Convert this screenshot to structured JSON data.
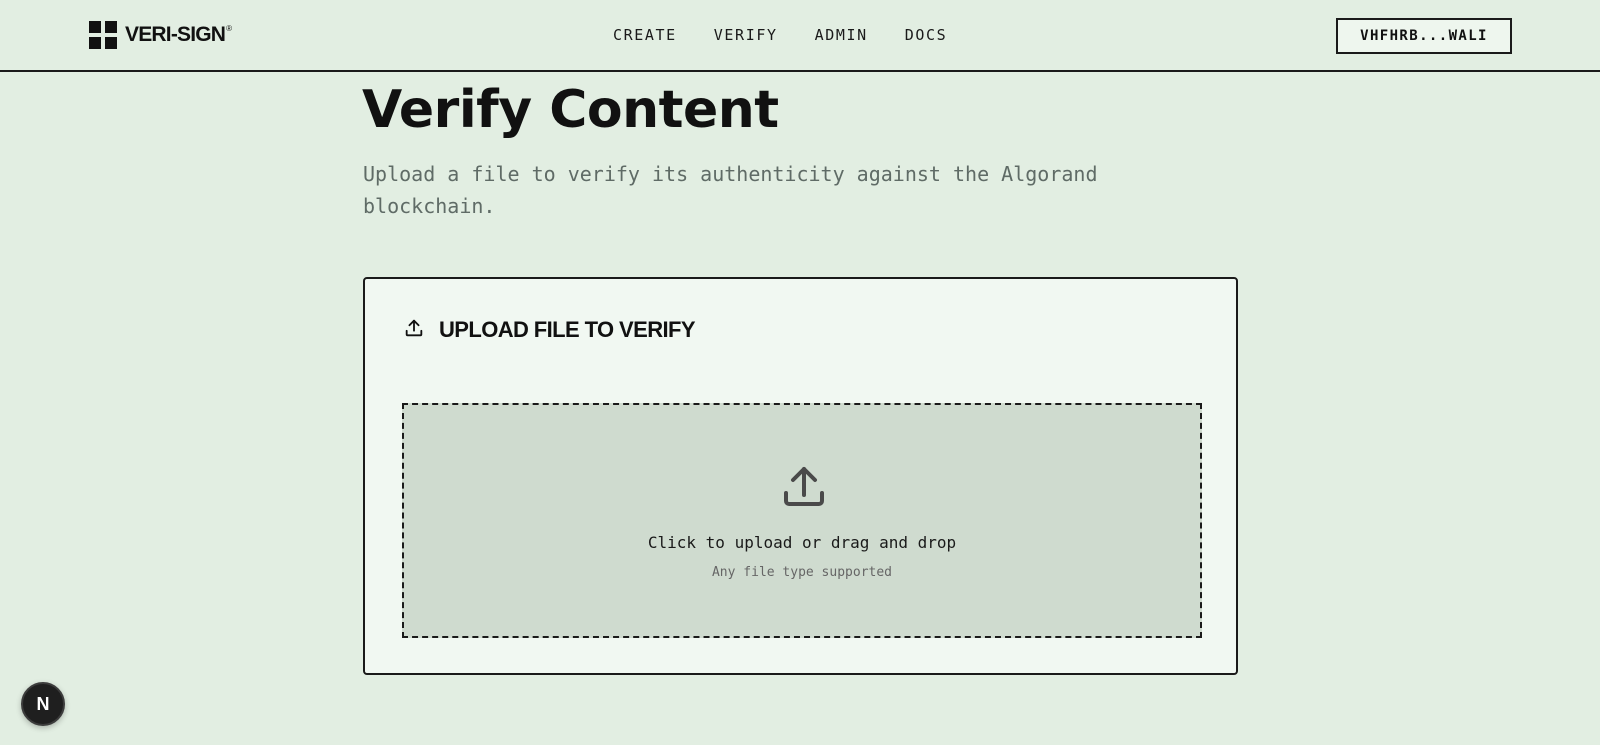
{
  "brand": {
    "name": "VERI-SIGN",
    "registered": "®"
  },
  "nav": {
    "items": [
      {
        "label": "CREATE"
      },
      {
        "label": "VERIFY"
      },
      {
        "label": "ADMIN"
      },
      {
        "label": "DOCS"
      }
    ]
  },
  "wallet": {
    "label": "VHFHRB...WALI"
  },
  "page": {
    "title": "Verify Content",
    "subtitle": "Upload a file to verify its authenticity against the Algorand blockchain."
  },
  "card": {
    "title": "UPLOAD FILE TO VERIFY",
    "title_icon": "upload-icon"
  },
  "dropzone": {
    "icon": "upload-icon",
    "primary": "Click to upload or drag and drop",
    "secondary": "Any file type supported"
  },
  "dev_badge": {
    "label": "N",
    "icon": "nextjs-logo-icon"
  },
  "colors": {
    "background": "#e2eee2",
    "card": "#f1f8f2",
    "dropzone": "#cfdbcf",
    "border": "#1a1a1a",
    "muted_text": "#5f6b66"
  }
}
